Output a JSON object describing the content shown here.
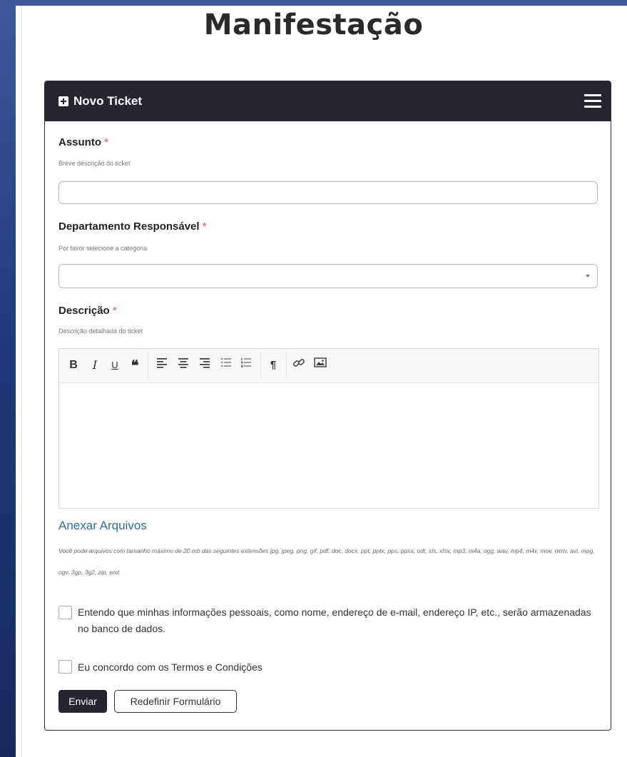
{
  "page": {
    "title": "Manifestação"
  },
  "card": {
    "title": "Novo Ticket"
  },
  "form": {
    "subject": {
      "label": "Assunto",
      "required_mark": "*",
      "help": "Breve descrição do ticket",
      "value": ""
    },
    "department": {
      "label": "Departamento Responsável",
      "required_mark": "*",
      "help": "Por favor selecione a categoria",
      "selected": ""
    },
    "description": {
      "label": "Descrição",
      "required_mark": "*",
      "help": "Descrição detalhada do ticket",
      "value": ""
    },
    "attachments": {
      "link": "Anexar Arquivos",
      "note": "Você pode arquivos com tamanho máximo de 20 mb das seguintes extensões jpg, jpeg, png, gif, pdf, doc, docx, ppt, pptx, pps, ppsx, odt, xls, xlsx, mp3, m4a, ogg, wav, mp4, m4v, mov, wmv, avi, mpg, ogv, 3gp, 3g2, zip, eml."
    },
    "consent_privacy": {
      "label": "Entendo que minhas informações pessoais, como nome, endereço de e-mail, endereço IP, etc., serão armazenadas no banco de dados.",
      "checked": false
    },
    "consent_terms": {
      "label": "Eu concordo com os Termos e Condições",
      "checked": false
    },
    "submit_label": "Enviar",
    "reset_label": "Redefinir Formulário"
  },
  "toolbar": {
    "bold": "B",
    "italic": "I",
    "underline": "U",
    "quote": "❝",
    "paragraph": "¶"
  }
}
